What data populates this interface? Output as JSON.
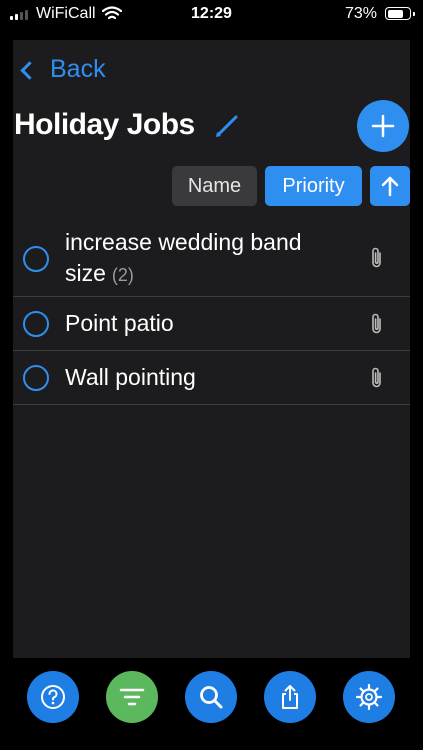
{
  "status": {
    "carrier": "WiFiCall",
    "time": "12:29",
    "battery_pct": "73%"
  },
  "nav": {
    "back_label": "Back"
  },
  "header": {
    "title": "Holiday Jobs"
  },
  "sort": {
    "name_label": "Name",
    "priority_label": "Priority",
    "active": "Priority",
    "direction": "ascending"
  },
  "tasks": [
    {
      "line1": "increase wedding band",
      "line2": "size",
      "count": "(2)"
    },
    {
      "label": "Point patio"
    },
    {
      "label": "Wall pointing"
    }
  ],
  "toolbar": {
    "icons": [
      "help-icon",
      "filter-icon",
      "search-icon",
      "share-icon",
      "settings-icon"
    ],
    "colors": {
      "help": "#1e7ee4",
      "filter": "#5cb85c",
      "search": "#1e7ee4",
      "share": "#1e7ee4",
      "settings": "#1e7ee4"
    }
  },
  "colors": {
    "accent": "#2f8ff0",
    "panel": "#1c1c1e",
    "background": "#000000"
  }
}
